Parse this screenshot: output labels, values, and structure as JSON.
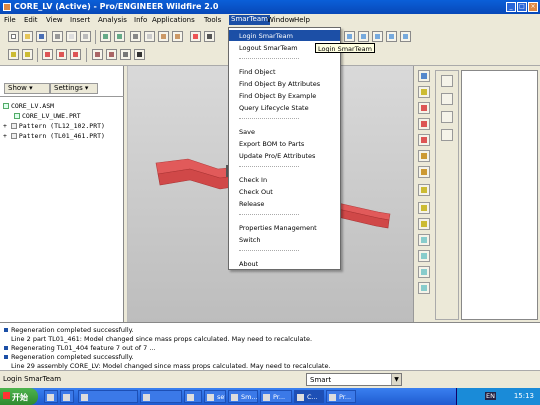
{
  "window": {
    "title": "CORE_LV (Active) - Pro/ENGINEER Wildfire 2.0"
  },
  "menu": {
    "items": [
      "File",
      "Edit",
      "View",
      "Insert",
      "Analysis",
      "Info",
      "Applications",
      "Tools",
      "SmarTeam",
      "Window",
      "Help"
    ],
    "open_menu": "SmarTeam"
  },
  "smarteam_menu": {
    "items": [
      "Login SmarTeam",
      "Logout SmarTeam",
      "Find Object",
      "Find Object By Attributes",
      "Find Object By Example",
      "Query Lifecycle State",
      "Save",
      "Export BOM to Parts",
      "Update Pro/E Attributes",
      "Check In",
      "Check Out",
      "Release",
      "Properties Management",
      "Switch",
      "About"
    ],
    "highlighted": "Login SmarTeam"
  },
  "tooltip": {
    "text": "Login SmarTeam"
  },
  "left_panel": {
    "tabs": {
      "show": "Show ▾",
      "settings": "Settings ▾"
    },
    "tree": [
      {
        "label": "CORE_LV.ASM",
        "indent": 0,
        "expander": ""
      },
      {
        "label": "CORE_LV_UWE.PRT",
        "indent": 1,
        "expander": ""
      },
      {
        "label": "Pattern (TL12_102.PRT)",
        "indent": 0,
        "expander": "+"
      },
      {
        "label": "Pattern (TL01_461.PRT)",
        "indent": 0,
        "expander": "+"
      }
    ]
  },
  "messages": [
    "Regeneration completed successfully.",
    "Line 2 part TL01_461: Model changed since mass props calculated. May need to recalculate.",
    "Regenerating TL01_404 feature 7 out of 7 ...",
    "Regeneration completed successfully.",
    "Line 29 assembly CORE_LV: Model changed since mass props calculated. May need to recalculate."
  ],
  "status": {
    "text": "Login SmarTeam",
    "smart_filter": "Smart"
  },
  "taskbar": {
    "start_label": "开始",
    "tasks": [
      "",
      "",
      "",
      "set...",
      "Sm...",
      "Pr...",
      "C...",
      "Pr..."
    ],
    "clock": "15:13",
    "ime": "EN"
  },
  "colors": {
    "menu_highlight": "#1c4fa6",
    "model_red": "#e15a5a",
    "titlebar": "#0a5fd8"
  }
}
